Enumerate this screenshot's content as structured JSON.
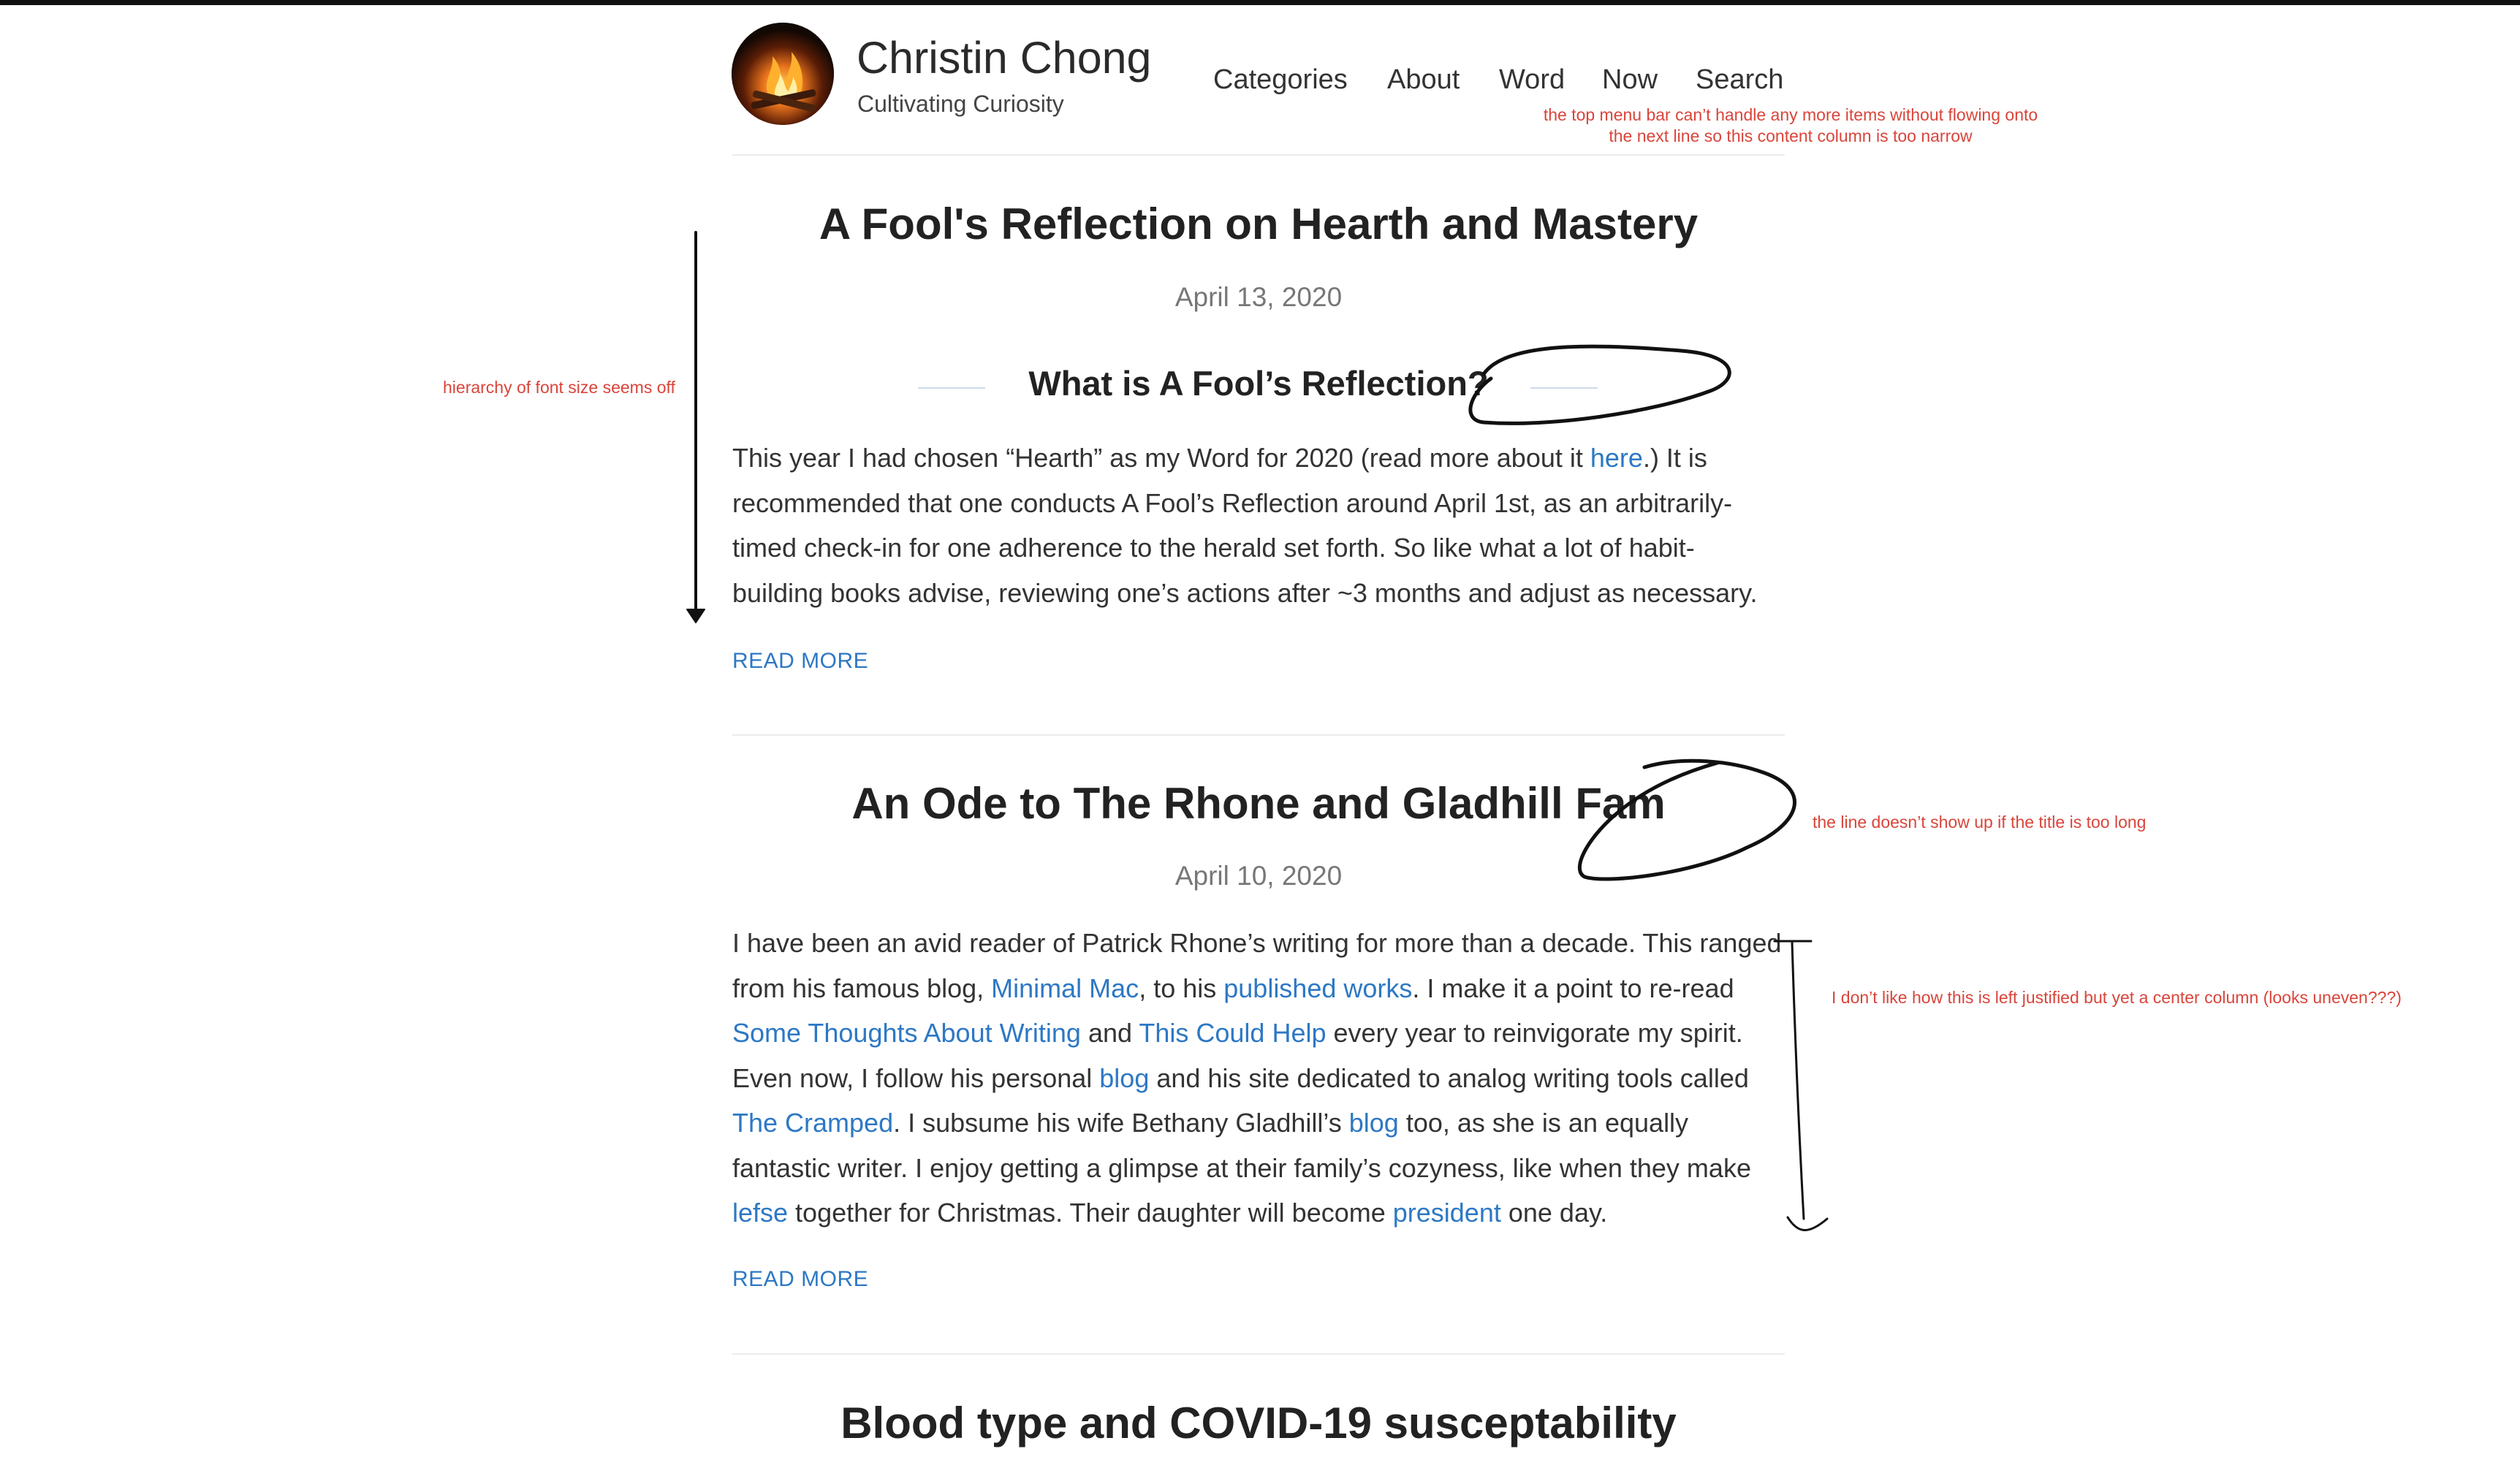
{
  "site": {
    "title": "Christin Chong",
    "tagline": "Cultivating Curiosity",
    "nav": [
      "Categories",
      "About",
      "Word",
      "Now",
      "Search"
    ]
  },
  "posts": [
    {
      "title": "A Fool's Reflection on Hearth and Mastery",
      "date": "April 13, 2020",
      "subheading": "What is A Fool’s Reflection?",
      "read_more": "READ MORE"
    },
    {
      "title": "An Ode to The Rhone and Gladhill Fam",
      "date": "April 10, 2020",
      "read_more": "READ MORE"
    },
    {
      "title": "Blood type and COVID-19 susceptability"
    }
  ],
  "post1_paragraph": [
    {
      "text": "This year I had chosen “Hearth” as my Word for 2020 (read more about it "
    },
    {
      "link": "here"
    },
    {
      "text": ".) It is recommended that one conducts A Fool’s Reflection around April 1st, as an arbitrarily-timed check-in for one adherence to the herald set forth. So like what a lot of habit-building books advise, reviewing one’s actions after ~3 months and adjust as necessary."
    }
  ],
  "post2_paragraph": [
    {
      "text": "I have been an avid reader of Patrick Rhone’s writing for more than a decade. This ranged from his famous blog, "
    },
    {
      "link": "Minimal Mac"
    },
    {
      "text": ", to his "
    },
    {
      "link": "published works"
    },
    {
      "text": ". I make it a point to re-read "
    },
    {
      "link": "Some Thoughts About Writing"
    },
    {
      "text": " and "
    },
    {
      "link": "This Could Help"
    },
    {
      "text": " every year to reinvigorate my spirit. Even now, I follow his personal "
    },
    {
      "link": "blog"
    },
    {
      "text": " and his site dedicated to analog writing tools called "
    },
    {
      "link": "The Cramped"
    },
    {
      "text": ". I subsume his wife Bethany Gladhill’s "
    },
    {
      "link": "blog"
    },
    {
      "text": " too, as she is an equally fantastic writer. I enjoy getting a glimpse at their family’s cozyness, like when they make "
    },
    {
      "link": "lefse"
    },
    {
      "text": " together for Christmas. Their daughter will become "
    },
    {
      "link": "president"
    },
    {
      "text": " one day."
    }
  ],
  "annotations": {
    "menu_note": [
      "the top menu bar can’t handle any more items without flowing onto",
      "the next line so this content column is too narrow"
    ],
    "hierarchy_note": "hierarchy of font size seems off",
    "line_note": "the line doesn’t show up if the title is too long",
    "justify_note": "I don’t like how this is left justified but yet a center column (looks uneven???)"
  },
  "colors": {
    "link": "#2d78c4",
    "annotation": "#d9453b",
    "rule": "#ececec"
  }
}
